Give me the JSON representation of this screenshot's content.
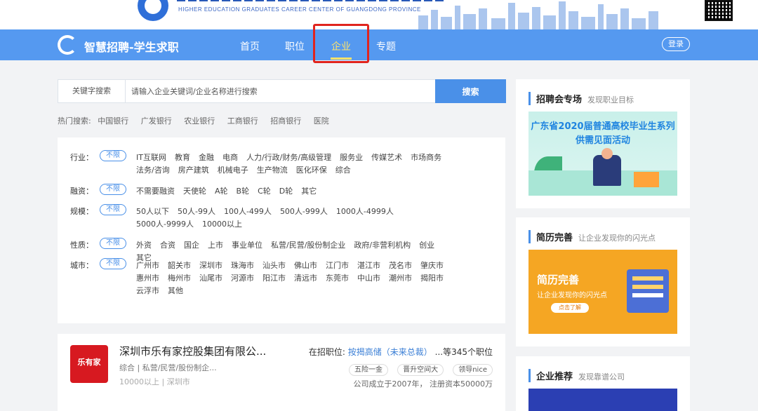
{
  "banner": {
    "subtitle_en": "HIGHER EDUCATION GRADUATES CAREER CENTER OF GUANGDONG PROVINCE"
  },
  "nav": {
    "brand": "智慧招聘-学生求职",
    "items": [
      {
        "label": "首页"
      },
      {
        "label": "职位"
      },
      {
        "label": "企业"
      },
      {
        "label": "专题"
      }
    ],
    "active_index": 2,
    "login": "登录"
  },
  "search": {
    "label": "关键字搜索",
    "placeholder": "请输入企业关键词/企业名称进行搜索",
    "button": "搜索"
  },
  "hot": {
    "label": "热门搜索:",
    "items": [
      "中国银行",
      "广发银行",
      "农业银行",
      "工商银行",
      "招商银行",
      "医院"
    ]
  },
  "filters": {
    "any_label": "不限",
    "rows": [
      {
        "label": "行业：",
        "options": [
          "IT互联网",
          "教育",
          "金融",
          "电商",
          "人力/行政/财务/高级管理",
          "服务业",
          "传媒艺术",
          "市场商务",
          "法务/咨询",
          "房产建筑",
          "机械电子",
          "生产物流",
          "医化环保",
          "综合"
        ]
      },
      {
        "label": "融资：",
        "options": [
          "不需要融资",
          "天使轮",
          "A轮",
          "B轮",
          "C轮",
          "D轮",
          "其它"
        ]
      },
      {
        "label": "规模：",
        "options": [
          "50人以下",
          "50人-99人",
          "100人-499人",
          "500人-999人",
          "1000人-4999人",
          "5000人-9999人",
          "10000以上"
        ]
      },
      {
        "label": "性质：",
        "options": [
          "外资",
          "合资",
          "国企",
          "上市",
          "事业单位",
          "私营/民营/股份制企业",
          "政府/非营利机构",
          "创业",
          "其它"
        ]
      },
      {
        "label": "城市：",
        "options": [
          "广州市",
          "韶关市",
          "深圳市",
          "珠海市",
          "汕头市",
          "佛山市",
          "江门市",
          "湛江市",
          "茂名市",
          "肇庆市",
          "惠州市",
          "梅州市",
          "汕尾市",
          "河源市",
          "阳江市",
          "清远市",
          "东莞市",
          "中山市",
          "潮州市",
          "揭阳市",
          "云浮市",
          "其他"
        ]
      }
    ]
  },
  "company": {
    "logo_text": "乐有家",
    "name": "深圳市乐有家控股集团有限公...",
    "type": "综合 | 私营/民营/股份制企...",
    "size": "10000以上 | 深圳市",
    "jobs_prefix": "在招职位:",
    "jobs_link": "按揭高储（未来总裁）",
    "jobs_suffix": "...等345个职位",
    "tags": [
      "五险一金",
      "晋升空间大",
      "领导nice"
    ],
    "founded": "公司成立于2007年，  注册资本50000万"
  },
  "sidebar": {
    "fair": {
      "title": "招聘会专场",
      "sub": "发现职业目标",
      "banner_text": "广东省2020届普通高校毕业生系列供需见面活动"
    },
    "resume": {
      "title": "简历完善",
      "sub": "让企业发现你的闪光点",
      "banner_big": "简历完善",
      "banner_small": "让企业发现你的闪光点",
      "banner_btn": "点击了解"
    },
    "recommend": {
      "title": "企业推荐",
      "sub": "发现靠谱公司"
    }
  },
  "colors": {
    "nav_bg": "#5599f0",
    "accent": "#4a90e8",
    "active_nav": "#ffe36b",
    "highlight": "#e0241e"
  }
}
